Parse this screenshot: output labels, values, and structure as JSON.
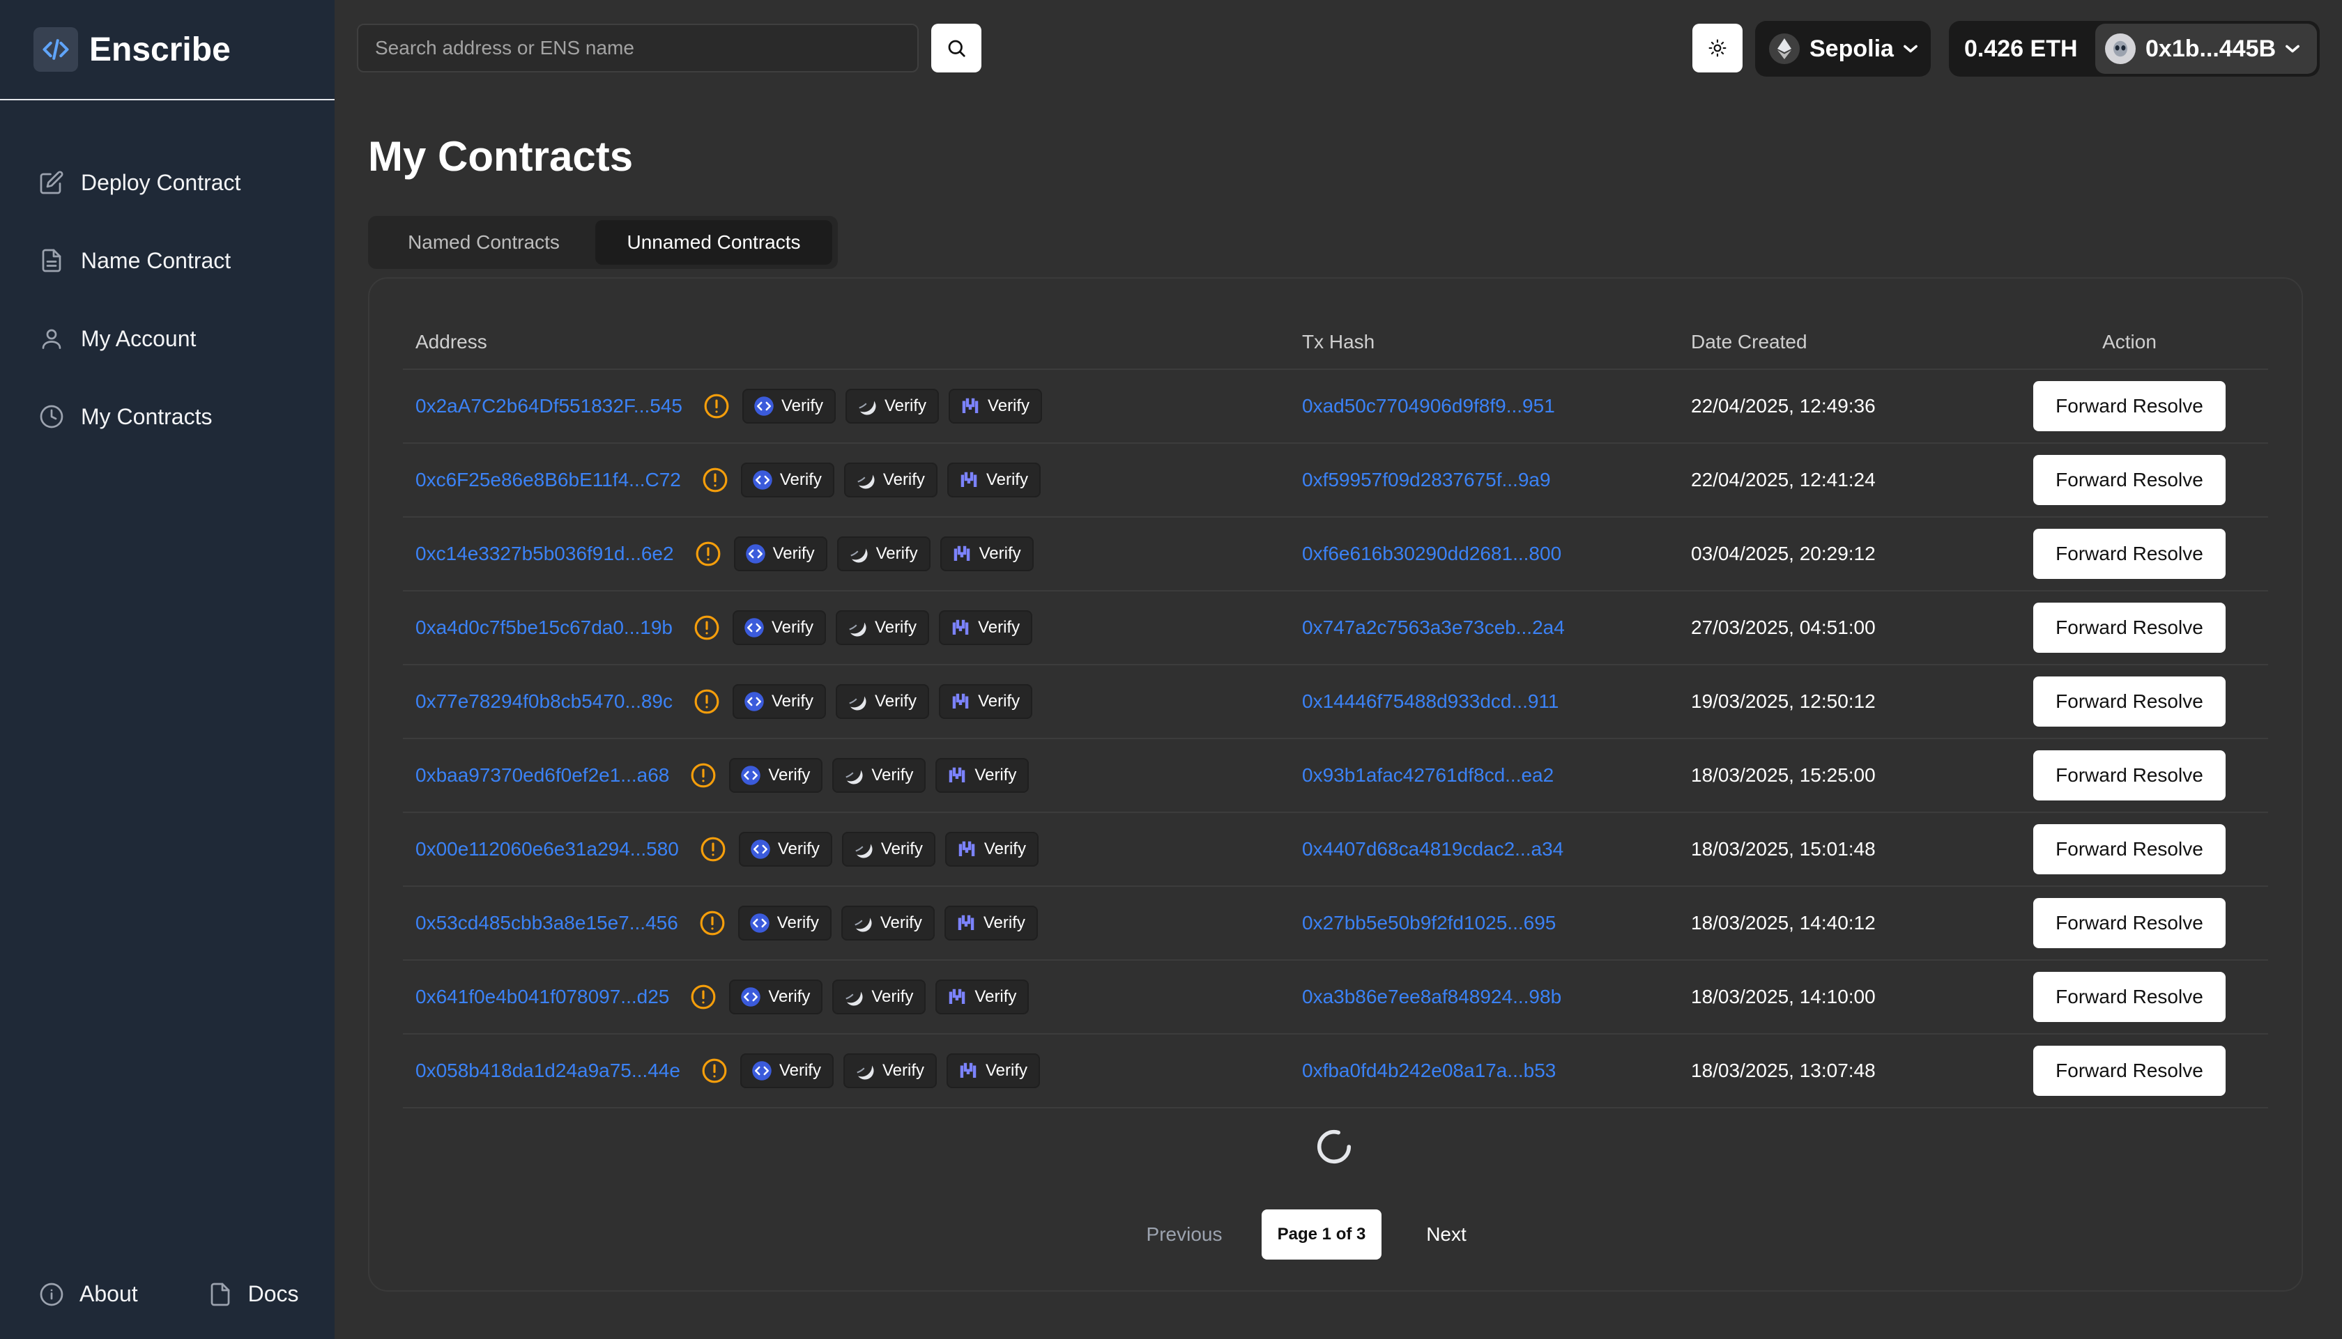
{
  "app": {
    "name": "Enscribe"
  },
  "sidebar": {
    "items": [
      {
        "label": "Deploy Contract",
        "icon": "edit-icon"
      },
      {
        "label": "Name Contract",
        "icon": "document-icon"
      },
      {
        "label": "My Account",
        "icon": "user-icon"
      },
      {
        "label": "My Contracts",
        "icon": "clock-icon"
      }
    ],
    "footer": {
      "about": "About",
      "docs": "Docs"
    }
  },
  "header": {
    "search_placeholder": "Search address or ENS name",
    "network": "Sepolia",
    "balance": "0.426 ETH",
    "account": "0x1b...445B"
  },
  "page": {
    "title": "My Contracts"
  },
  "tabs": [
    {
      "label": "Named Contracts",
      "active": false
    },
    {
      "label": "Unnamed Contracts",
      "active": true
    }
  ],
  "table": {
    "columns": [
      "Address",
      "Tx Hash",
      "Date Created",
      "Action"
    ],
    "verify_label": "Verify",
    "action_label": "Forward Resolve",
    "rows": [
      {
        "address": "0x2aA7C2b64Df551832F...545",
        "tx": "0xad50c7704906d9f8f9...951",
        "date": "22/04/2025, 12:49:36"
      },
      {
        "address": "0xc6F25e86e8B6bE11f4...C72",
        "tx": "0xf59957f09d2837675f...9a9",
        "date": "22/04/2025, 12:41:24"
      },
      {
        "address": "0xc14e3327b5b036f91d...6e2",
        "tx": "0xf6e616b30290dd2681...800",
        "date": "03/04/2025, 20:29:12"
      },
      {
        "address": "0xa4d0c7f5be15c67da0...19b",
        "tx": "0x747a2c7563a3e73ceb...2a4",
        "date": "27/03/2025, 04:51:00"
      },
      {
        "address": "0x77e78294f0b8cb5470...89c",
        "tx": "0x14446f75488d933dcd...911",
        "date": "19/03/2025, 12:50:12"
      },
      {
        "address": "0xbaa97370ed6f0ef2e1...a68",
        "tx": "0x93b1afac42761df8cd...ea2",
        "date": "18/03/2025, 15:25:00"
      },
      {
        "address": "0x00e112060e6e31a294...580",
        "tx": "0x4407d68ca4819cdac2...a34",
        "date": "18/03/2025, 15:01:48"
      },
      {
        "address": "0x53cd485cbb3a8e15e7...456",
        "tx": "0x27bb5e50b9f2fd1025...695",
        "date": "18/03/2025, 14:40:12"
      },
      {
        "address": "0x641f0e4b041f078097...d25",
        "tx": "0xa3b86e7ee8af848924...98b",
        "date": "18/03/2025, 14:10:00"
      },
      {
        "address": "0x058b418da1d24a9a75...44e",
        "tx": "0xfba0fd4b242e08a17a...b53",
        "date": "18/03/2025, 13:07:48"
      }
    ]
  },
  "pagination": {
    "previous": "Previous",
    "current": "Page 1 of 3",
    "next": "Next"
  },
  "colors": {
    "link": "#3b82f6",
    "warning": "#f59e0b",
    "sidebar": "#1f2937",
    "background": "#303030"
  }
}
